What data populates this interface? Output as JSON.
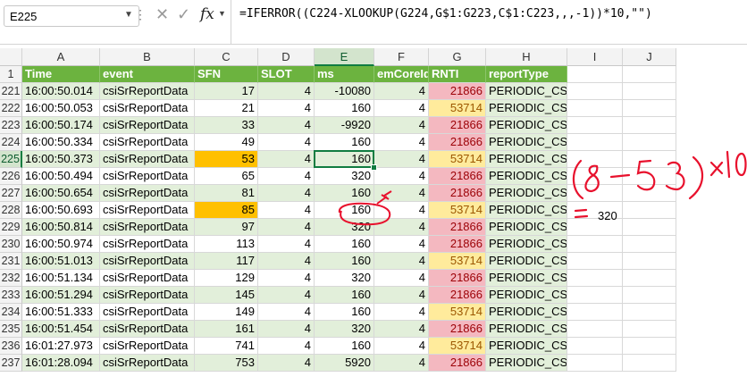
{
  "formula_bar": {
    "name_box": "E225",
    "formula": "=IFERROR((C224-XLOOKUP(G224,G$1:G223,C$1:C223,,,-1))*10,\"\")"
  },
  "columns": [
    "A",
    "B",
    "C",
    "D",
    "E",
    "F",
    "G",
    "H",
    "I",
    "J"
  ],
  "selected_column": "E",
  "header_row": {
    "row_num": "1",
    "cells": [
      "Time",
      "event",
      "SFN",
      "SLOT",
      "ms",
      "emCoreId",
      "RNTI",
      "reportType",
      "",
      ""
    ]
  },
  "rows": [
    {
      "row": "221",
      "time": "16:00:50.014",
      "event": "csiSrReportData",
      "sfn": "17",
      "slot": "4",
      "ms": "-10080",
      "core": "4",
      "rnti": "21866",
      "report": "PERIODIC_CSI"
    },
    {
      "row": "222",
      "time": "16:00:50.053",
      "event": "csiSrReportData",
      "sfn": "21",
      "slot": "4",
      "ms": "160",
      "core": "4",
      "rnti": "53714",
      "report": "PERIODIC_CSI"
    },
    {
      "row": "223",
      "time": "16:00:50.174",
      "event": "csiSrReportData",
      "sfn": "33",
      "slot": "4",
      "ms": "-9920",
      "core": "4",
      "rnti": "21866",
      "report": "PERIODIC_CSI"
    },
    {
      "row": "224",
      "time": "16:00:50.334",
      "event": "csiSrReportData",
      "sfn": "49",
      "slot": "4",
      "ms": "160",
      "core": "4",
      "rnti": "21866",
      "report": "PERIODIC_CSI"
    },
    {
      "row": "225",
      "time": "16:00:50.373",
      "event": "csiSrReportData",
      "sfn": "53",
      "slot": "4",
      "ms": "160",
      "core": "4",
      "rnti": "53714",
      "report": "PERIODIC_CSI"
    },
    {
      "row": "226",
      "time": "16:00:50.494",
      "event": "csiSrReportData",
      "sfn": "65",
      "slot": "4",
      "ms": "320",
      "core": "4",
      "rnti": "21866",
      "report": "PERIODIC_CSI"
    },
    {
      "row": "227",
      "time": "16:00:50.654",
      "event": "csiSrReportData",
      "sfn": "81",
      "slot": "4",
      "ms": "160",
      "core": "4",
      "rnti": "21866",
      "report": "PERIODIC_CSI"
    },
    {
      "row": "228",
      "time": "16:00:50.693",
      "event": "csiSrReportData",
      "sfn": "85",
      "slot": "4",
      "ms": "160",
      "core": "4",
      "rnti": "53714",
      "report": "PERIODIC_CSI"
    },
    {
      "row": "229",
      "time": "16:00:50.814",
      "event": "csiSrReportData",
      "sfn": "97",
      "slot": "4",
      "ms": "320",
      "core": "4",
      "rnti": "21866",
      "report": "PERIODIC_CSI"
    },
    {
      "row": "230",
      "time": "16:00:50.974",
      "event": "csiSrReportData",
      "sfn": "113",
      "slot": "4",
      "ms": "160",
      "core": "4",
      "rnti": "21866",
      "report": "PERIODIC_CSI"
    },
    {
      "row": "231",
      "time": "16:00:51.013",
      "event": "csiSrReportData",
      "sfn": "117",
      "slot": "4",
      "ms": "160",
      "core": "4",
      "rnti": "53714",
      "report": "PERIODIC_CSI"
    },
    {
      "row": "232",
      "time": "16:00:51.134",
      "event": "csiSrReportData",
      "sfn": "129",
      "slot": "4",
      "ms": "320",
      "core": "4",
      "rnti": "21866",
      "report": "PERIODIC_CSI"
    },
    {
      "row": "233",
      "time": "16:00:51.294",
      "event": "csiSrReportData",
      "sfn": "145",
      "slot": "4",
      "ms": "160",
      "core": "4",
      "rnti": "21866",
      "report": "PERIODIC_CSI"
    },
    {
      "row": "234",
      "time": "16:00:51.333",
      "event": "csiSrReportData",
      "sfn": "149",
      "slot": "4",
      "ms": "160",
      "core": "4",
      "rnti": "53714",
      "report": "PERIODIC_CSI"
    },
    {
      "row": "235",
      "time": "16:00:51.454",
      "event": "csiSrReportData",
      "sfn": "161",
      "slot": "4",
      "ms": "320",
      "core": "4",
      "rnti": "21866",
      "report": "PERIODIC_CSI"
    },
    {
      "row": "236",
      "time": "16:01:27.973",
      "event": "csiSrReportData",
      "sfn": "741",
      "slot": "4",
      "ms": "160",
      "core": "4",
      "rnti": "53714",
      "report": "PERIODIC_CSI"
    },
    {
      "row": "237",
      "time": "16:01:28.094",
      "event": "csiSrReportData",
      "sfn": "753",
      "slot": "4",
      "ms": "5920",
      "core": "4",
      "rnti": "21866",
      "report": "PERIODIC_CSI"
    }
  ],
  "highlight_sfn_rows": [
    "225",
    "228"
  ],
  "active_cell": {
    "col": "E",
    "row": "225"
  },
  "colors": {
    "header_green": "#6cb33f",
    "row_green": "#e2efda",
    "orange": "#ffc000",
    "rnti_red": "#f4b8c0",
    "rnti_yellow": "#ffeb9c",
    "selection": "#107c41",
    "annotation_red": "#e8112d"
  },
  "annotations": {
    "handwritten_formula": "(85-53)x10",
    "equals_mark": "=",
    "result": "320",
    "circled_value": "160"
  }
}
